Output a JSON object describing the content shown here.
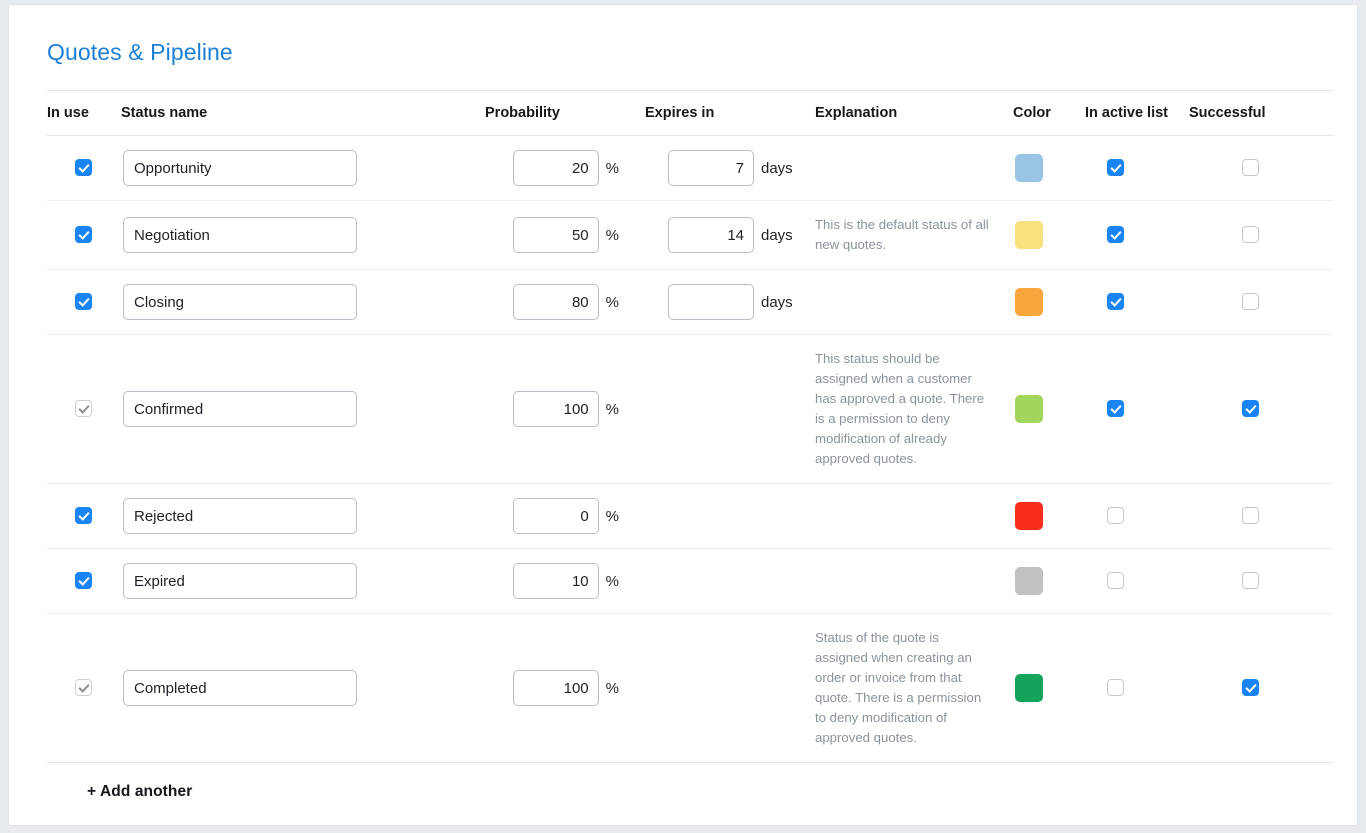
{
  "page": {
    "title": "Quotes & Pipeline",
    "accent_color": "#1c7fd6"
  },
  "table": {
    "headers": {
      "in_use": "In use",
      "status_name": "Status name",
      "probability": "Probability",
      "expires_in": "Expires in",
      "explanation": "Explanation",
      "color": "Color",
      "in_active_list": "In active list",
      "successful": "Successful"
    },
    "units": {
      "percent": "%",
      "days": "days"
    },
    "rows": [
      {
        "in_use": true,
        "in_use_disabled": false,
        "name": "Opportunity",
        "probability": "20",
        "expires_in": "7",
        "has_expires": true,
        "explanation": "",
        "color": "#9ac4e3",
        "in_active_list": true,
        "successful": false
      },
      {
        "in_use": true,
        "in_use_disabled": false,
        "name": "Negotiation",
        "probability": "50",
        "expires_in": "14",
        "has_expires": true,
        "explanation": "This is the default status of all new quotes.",
        "color": "#f8e07c",
        "in_active_list": true,
        "successful": false
      },
      {
        "in_use": true,
        "in_use_disabled": false,
        "name": "Closing",
        "probability": "80",
        "expires_in": "",
        "has_expires": true,
        "explanation": "",
        "color": "#f9a63c",
        "in_active_list": true,
        "successful": false
      },
      {
        "in_use": true,
        "in_use_disabled": true,
        "name": "Confirmed",
        "probability": "100",
        "expires_in": "",
        "has_expires": false,
        "explanation": "This status should be assigned when a customer has approved a quote. There is a permission to deny modification of already approved quotes.",
        "color": "#a2d45e",
        "in_active_list": true,
        "successful": true
      },
      {
        "in_use": true,
        "in_use_disabled": false,
        "name": "Rejected",
        "probability": "0",
        "expires_in": "",
        "has_expires": false,
        "explanation": "",
        "color": "#f62d1b",
        "in_active_list": false,
        "successful": false
      },
      {
        "in_use": true,
        "in_use_disabled": false,
        "name": "Expired",
        "probability": "10",
        "expires_in": "",
        "has_expires": false,
        "explanation": "",
        "color": "#bfc1c3",
        "in_active_list": false,
        "successful": false
      },
      {
        "in_use": true,
        "in_use_disabled": true,
        "name": "Completed",
        "probability": "100",
        "expires_in": "",
        "has_expires": false,
        "explanation": "Status of the quote is assigned when creating an order or invoice from that quote. There is a permission to deny modification of approved quotes.",
        "color": "#13a359",
        "in_active_list": false,
        "successful": true
      }
    ],
    "add_another_label": "+ Add another"
  }
}
